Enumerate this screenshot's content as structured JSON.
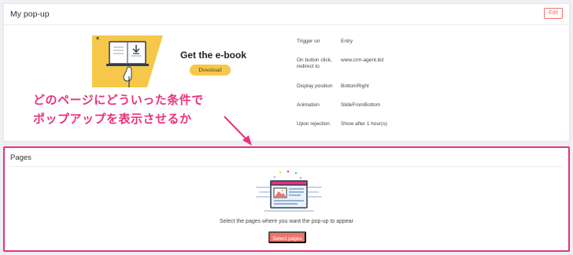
{
  "popup_card": {
    "title": "My pop-up",
    "edit_label": "Edit",
    "preview": {
      "heading": "Get the e-book",
      "download_label": "Download",
      "close_glyph": "×"
    },
    "settings": [
      {
        "label": "Trigger on",
        "value": "Entry"
      },
      {
        "label": "On button click, redirect to",
        "value": "www.crm-agent.biz"
      },
      {
        "label": "Display position",
        "value": "BottomRight"
      },
      {
        "label": "Animation",
        "value": "SlideFromBottom"
      },
      {
        "label": "Upon rejection",
        "value": "Show after 1 hour(s)"
      }
    ]
  },
  "annotation": {
    "line1": "どのページにどういった条件で",
    "line2": "ポップアップを表示させるか",
    "color": "#e8337c"
  },
  "pages_card": {
    "title": "Pages",
    "help_text": "Select the pages where you want the pop-up to appear",
    "select_label": "Select pages"
  },
  "colors": {
    "accent": "#f0736b",
    "highlight": "#e8337c",
    "banner_yellow": "#f6c84a"
  }
}
